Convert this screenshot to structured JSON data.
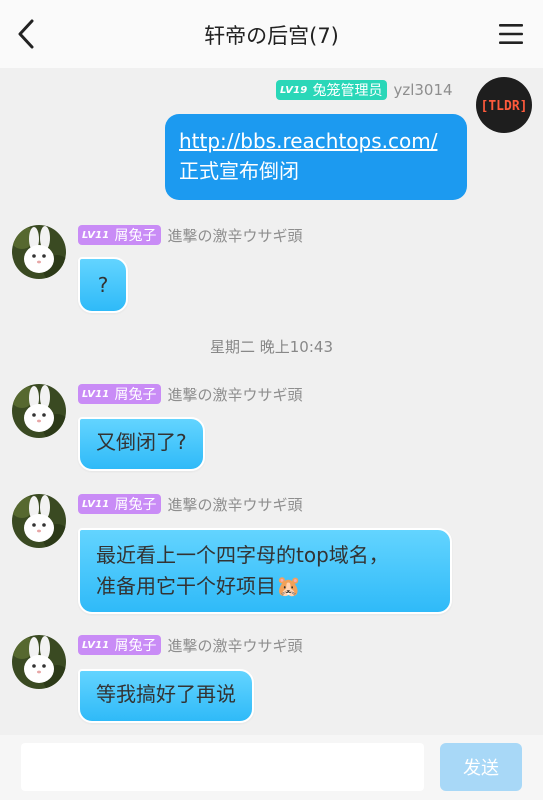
{
  "header": {
    "title": "轩帝の后宫(7)",
    "back_icon": "chevron-left-icon",
    "menu_icon": "hamburger-menu-icon"
  },
  "messages": [
    {
      "side": "right",
      "level": "LV19",
      "role": "兔笼管理员",
      "nickname": "yzl3014",
      "avatar_text": "[TLDR]",
      "lines": [
        "http://bbs.reachtops.com/",
        "正式宣布倒闭"
      ]
    },
    {
      "side": "left",
      "level": "LV11",
      "role": "屑兔子",
      "nickname": "進撃の激辛ウサギ頭",
      "text": "?"
    },
    {
      "side": "left",
      "level": "LV11",
      "role": "屑兔子",
      "nickname": "進撃の激辛ウサギ頭",
      "text": "又倒闭了?"
    },
    {
      "side": "left",
      "level": "LV11",
      "role": "屑兔子",
      "nickname": "進撃の激辛ウサギ頭",
      "lines": [
        "最近看上一个四字母的top域名，",
        "准备用它干个好项目"
      ],
      "emoji": "🐹"
    },
    {
      "side": "left",
      "level": "LV11",
      "role": "屑兔子",
      "nickname": "進撃の激辛ウサギ頭",
      "text": "等我搞好了再说"
    }
  ],
  "timestamp": "星期二 晚上10:43",
  "input": {
    "value": "",
    "placeholder": ""
  },
  "send_label": "发送",
  "colors": {
    "my_bubble": "#1c9af0",
    "their_bubble": "#3fc4fb",
    "admin_badge": "#2ad7b8",
    "member_badge": "#c98cf6",
    "send_button": "#a8d8f7"
  }
}
